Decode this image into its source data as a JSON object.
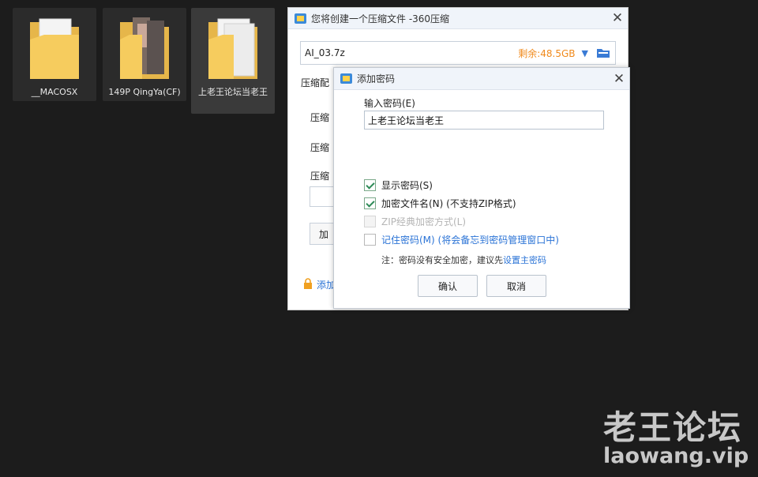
{
  "desktop": {
    "items": [
      {
        "label": "__MACOSX"
      },
      {
        "label": "149P QingYa(CF)"
      },
      {
        "label": "上老王论坛当老王"
      }
    ]
  },
  "back_dialog": {
    "title": "您将创建一个压缩文件 -360压缩",
    "filename": "AI_03.7z",
    "free_space": "剩余:48.5GB",
    "config_label": "压缩配",
    "row1_label": "压缩",
    "row2_label": "压缩",
    "row3_label": "压缩",
    "button_text": "加",
    "link_text": "添加"
  },
  "front_dialog": {
    "title": "添加密码",
    "input_label": "输入密码(E)",
    "password_value": "上老王论坛当老王",
    "options": {
      "show_password": "显示密码(S)",
      "encrypt_filenames": "加密文件名(N) (不支持ZIP格式)",
      "zip_classic": "ZIP经典加密方式(L)",
      "remember_password": "记住密码(M) (将会备忘到密码管理窗口中)"
    },
    "note_prefix": "注：密码没有安全加密，建议先",
    "note_link": "设置主密码",
    "ok_label": "确认",
    "cancel_label": "取消"
  },
  "watermark": {
    "line1": "老王论坛",
    "line2": "laowang.vip"
  },
  "colors": {
    "accent_blue": "#2a73d6",
    "free_space_orange": "#f08a1c",
    "check_green": "#2e8b57",
    "desktop_bg": "#1c1c1c"
  }
}
